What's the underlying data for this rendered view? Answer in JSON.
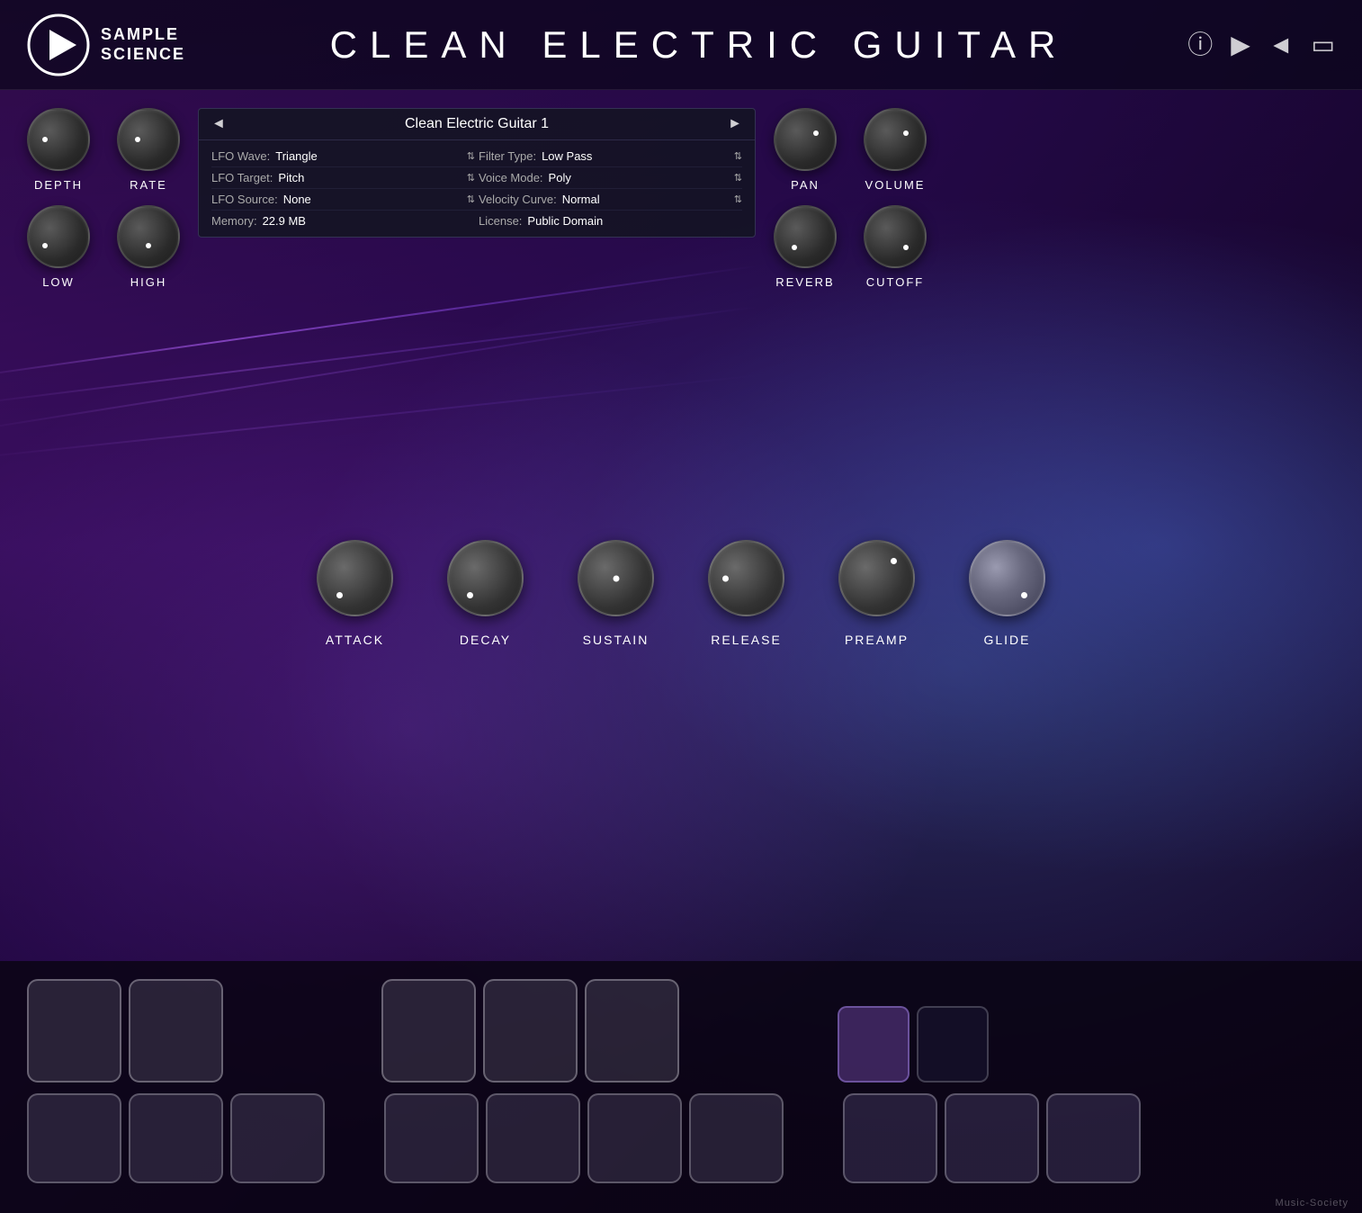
{
  "app": {
    "title": "CLEAN ELECTRIC GUITAR",
    "watermark": "Music-Society"
  },
  "logo": {
    "line1": "SAMPLE",
    "line2": "SCIENCE"
  },
  "header_buttons": {
    "info": "ⓘ",
    "play": "▶",
    "back": "◄",
    "menu": "▭"
  },
  "panel": {
    "title": "Clean Electric Guitar 1",
    "prev": "◄",
    "next": "►",
    "fields": {
      "lfo_wave_label": "LFO Wave:",
      "lfo_wave_value": "Triangle",
      "filter_type_label": "Filter Type:",
      "filter_type_value": "Low Pass",
      "lfo_target_label": "LFO Target:",
      "lfo_target_value": "Pitch",
      "voice_mode_label": "Voice Mode:",
      "voice_mode_value": "Poly",
      "lfo_source_label": "LFO Source:",
      "lfo_source_value": "None",
      "velocity_curve_label": "Velocity Curve:",
      "velocity_curve_value": "Normal",
      "memory_label": "Memory:",
      "memory_value": "22.9 MB",
      "license_label": "License:",
      "license_value": "Public Domain"
    }
  },
  "knobs_left": {
    "depth_label": "DEPTH",
    "rate_label": "RATE",
    "low_label": "LOW",
    "high_label": "HIGH"
  },
  "knobs_right": {
    "pan_label": "PAN",
    "volume_label": "VOLUME",
    "reverb_label": "REVERB",
    "cutoff_label": "CUTOFF"
  },
  "knobs_middle": {
    "attack_label": "ATTACK",
    "decay_label": "DECAY",
    "sustain_label": "SUSTAIN",
    "release_label": "RELEASE",
    "preamp_label": "PREAMP",
    "glide_label": "GLIDE"
  }
}
